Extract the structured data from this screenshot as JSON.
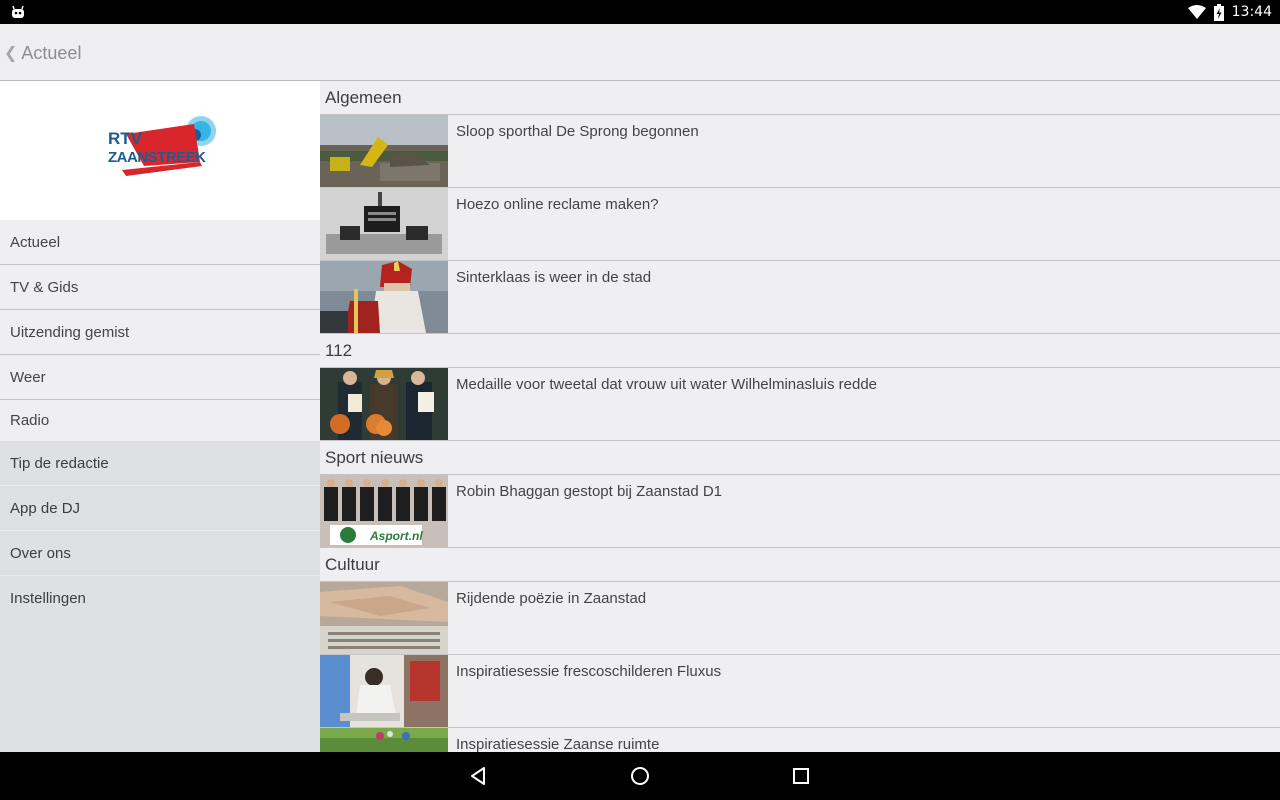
{
  "status": {
    "time": "13:44"
  },
  "actionbar": {
    "back_label": "Actueel"
  },
  "logo": {
    "line1": "RTV",
    "line2": "ZAANSTREEK"
  },
  "sidebar": {
    "primary": [
      {
        "label": "Actueel"
      },
      {
        "label": "TV & Gids"
      },
      {
        "label": "Uitzending gemist"
      },
      {
        "label": "Weer"
      },
      {
        "label": "Radio"
      }
    ],
    "secondary": [
      {
        "label": "Tip de redactie"
      },
      {
        "label": "App de DJ"
      },
      {
        "label": "Over ons"
      },
      {
        "label": "Instellingen"
      }
    ]
  },
  "content": {
    "sections": [
      {
        "title": "Algemeen",
        "items": [
          {
            "title": "Sloop sporthal De Sprong begonnen",
            "thumb": "demolition-site"
          },
          {
            "title": "Hoezo online reclame maken?",
            "thumb": "studio-equipment"
          },
          {
            "title": "Sinterklaas is weer in de stad",
            "thumb": "sinterklaas"
          }
        ]
      },
      {
        "title": "112",
        "items": [
          {
            "title": "Medaille voor tweetal dat vrouw uit water Wilhelminasluis redde",
            "thumb": "award-ceremony"
          }
        ]
      },
      {
        "title": "Sport nieuws",
        "items": [
          {
            "title": "Robin Bhaggan gestopt bij Zaanstad D1",
            "thumb": "team-photo",
            "thumb_caption": "Asport.nl"
          }
        ]
      },
      {
        "title": "Cultuur",
        "items": [
          {
            "title": "Rijdende poëzie in Zaanstad",
            "thumb": "typing-hands"
          },
          {
            "title": "Inspiratiesessie frescoschilderen Fluxus",
            "thumb": "painting-wall"
          },
          {
            "title": "Inspiratiesessie Zaanse ruimte",
            "thumb": "grass-field"
          }
        ]
      }
    ]
  },
  "colors": {
    "logo_red": "#d8262c",
    "logo_blue": "#1d5c92",
    "logo_cyan": "#36b4e5"
  }
}
